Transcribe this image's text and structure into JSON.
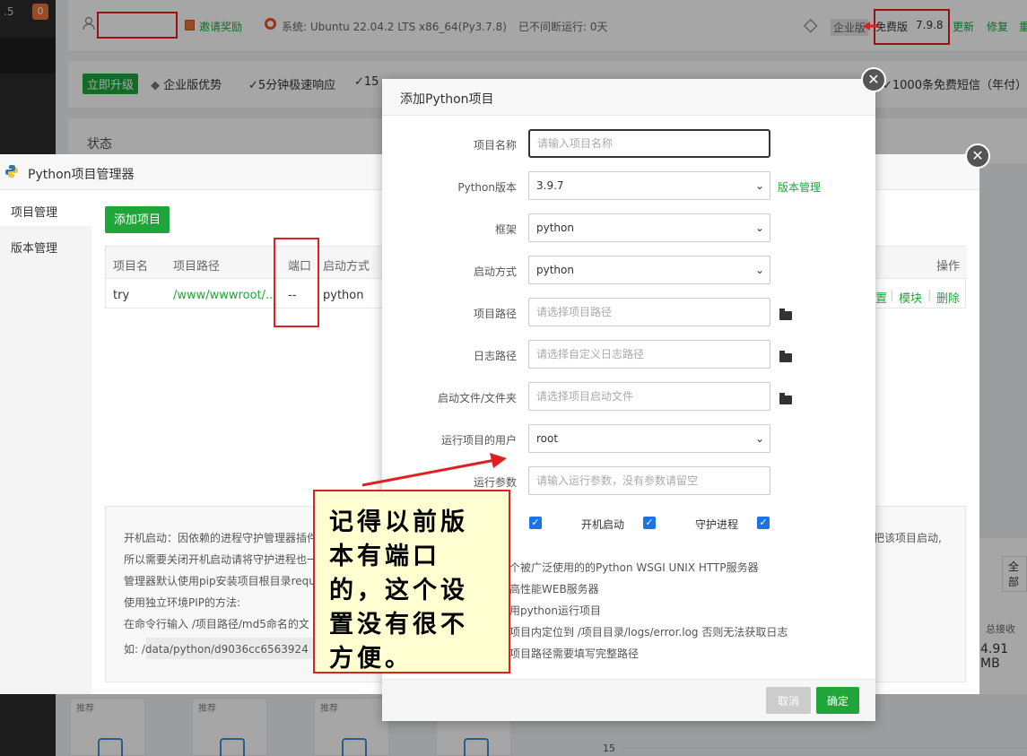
{
  "rail": {
    "version_frag": ".5",
    "badge": "0"
  },
  "topbar": {
    "invite": "邀请奖励",
    "system": "系统:  Ubuntu 22.04.2 LTS x86_64(Py3.7.8)",
    "uptime": "已不间断运行: 0天",
    "enterprise": "企业版",
    "free": "免费版",
    "version": "7.9.8",
    "update": "更新",
    "repair": "修复",
    "restart_frag": "重"
  },
  "promo": {
    "upgrade": "立即升级",
    "advantage": "企业版优势",
    "fast": "✓5分钟极速响应",
    "frag": "✓15",
    "sms": "✓1000条免费短信（年付）"
  },
  "status_title": "状态",
  "pm": {
    "title": "Python项目管理器",
    "side": [
      "项目管理",
      "版本管理"
    ],
    "add_button": "添加项目",
    "columns": {
      "name": "项目名",
      "path": "项目路径",
      "port": "端口",
      "start": "启动方式",
      "ops": "操作"
    },
    "row": {
      "name": "try",
      "path": "/www/wwwroot/...",
      "port": "--",
      "start": "python",
      "op_config_frag": "置",
      "op_sep1": "|",
      "op_module": "模块",
      "op_sep2": "|",
      "op_delete": "删除"
    },
    "help": [
      "开机启动：因依赖的进程守护管理器插件",
      "所以需要关闭开机启动请将守护进程也一",
      "管理器默认使用pip安装项目根目录requ",
      "使用独立环境PIP的方法:",
      "在命令行输入  /项目路径/md5命名的文",
      "如:  /data/python/d9036cc6563924"
    ],
    "help_right": "把该项目启动,"
  },
  "dialog": {
    "title": "添加Python项目",
    "name_label": "项目名称",
    "name_placeholder": "请输入项目名称",
    "pyver_label": "Python版本",
    "pyver_value": "3.9.7",
    "ver_manage": "版本管理",
    "framework_label": "框架",
    "framework_value": "python",
    "start_label": "启动方式",
    "start_value": "python",
    "path_label": "项目路径",
    "path_placeholder": "请选择项目路径",
    "log_label": "日志路径",
    "log_placeholder": "请选择自定义日志路径",
    "file_label": "启动文件/文件夹",
    "file_placeholder": "请选择项目启动文件",
    "user_label": "运行项目的用户",
    "user_value": "root",
    "args_label": "运行参数",
    "args_placeholder": "请输入运行参数，没有参数请留空",
    "boot_label": "开机启动",
    "daemon_label": "守护进程",
    "hints": [
      "个被广泛使用的的Python WSGI UNIX HTTP服务器",
      "高性能WEB服务器",
      "用python运行项目",
      "项目内定位到 /项目目录/logs/error.log 否则无法获取日志",
      "项目路径需要填写完整路径"
    ],
    "cancel": "取消",
    "ok": "确定"
  },
  "annotation": "记得以前版本有端口的，这个设置没有很不方便。",
  "bottom": {
    "rec": "推荐",
    "total_recv": "总接收",
    "total_recv_val": "4.91 MB",
    "full": "全部",
    "tick": "15"
  }
}
